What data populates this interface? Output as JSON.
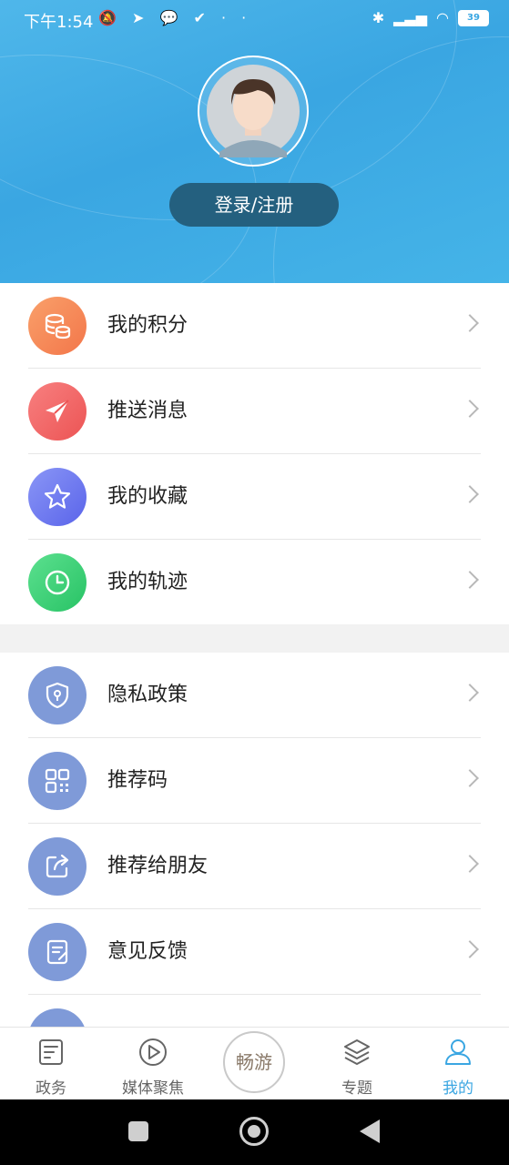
{
  "status_bar": {
    "time": "下午1:54",
    "left_icons": "🔕 ➤ 💬 ✔ · ·",
    "battery": "39"
  },
  "profile": {
    "login_label": "登录/注册"
  },
  "menu_group1": [
    {
      "label": "我的积分",
      "icon": "database-icon",
      "color": "#f5885a"
    },
    {
      "label": "推送消息",
      "icon": "paper-plane-icon",
      "color": "#f06a6a"
    },
    {
      "label": "我的收藏",
      "icon": "star-icon",
      "color": "#6b79f0"
    },
    {
      "label": "我的轨迹",
      "icon": "clock-icon",
      "color": "#3cd27a"
    }
  ],
  "menu_group2": [
    {
      "label": "隐私政策",
      "icon": "shield-icon",
      "color": "#7f9ad8"
    },
    {
      "label": "推荐码",
      "icon": "qrcode-icon",
      "color": "#7f9ad8"
    },
    {
      "label": "推荐给朋友",
      "icon": "share-icon",
      "color": "#7f9ad8"
    },
    {
      "label": "意见反馈",
      "icon": "feedback-icon",
      "color": "#7f9ad8"
    }
  ],
  "tabbar": {
    "tabs": [
      {
        "label": "政务",
        "icon": "document-icon"
      },
      {
        "label": "媒体聚焦",
        "icon": "play-icon"
      },
      {
        "label": "畅游",
        "icon": "logo-icon"
      },
      {
        "label": "专题",
        "icon": "layers-icon"
      },
      {
        "label": "我的",
        "icon": "user-icon",
        "active": true
      }
    ],
    "active_color": "#3aa6e2"
  }
}
